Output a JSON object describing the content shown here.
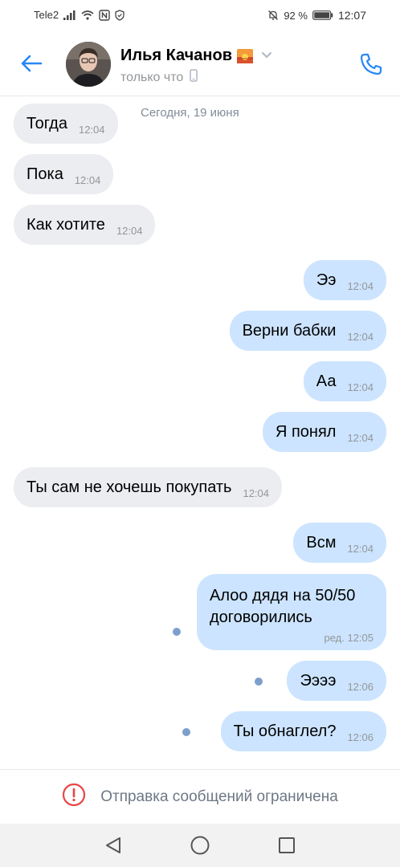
{
  "statusbar": {
    "carrier": "Tele2",
    "battery": "92 %",
    "time": "12:07"
  },
  "header": {
    "name": "Илья Качанов",
    "status": "только что"
  },
  "date_label": "Сегодня, 19 июня",
  "messages": [
    {
      "dir": "in",
      "text": "Тогда",
      "time": "12:04"
    },
    {
      "dir": "in",
      "text": "Пока",
      "time": "12:04"
    },
    {
      "dir": "in",
      "text": "Как хотите",
      "time": "12:04"
    },
    {
      "dir": "out",
      "text": "Ээ",
      "time": "12:04"
    },
    {
      "dir": "out",
      "text": "Верни бабки",
      "time": "12:04"
    },
    {
      "dir": "out",
      "text": "Аа",
      "time": "12:04"
    },
    {
      "dir": "out",
      "text": "Я понял",
      "time": "12:04"
    },
    {
      "dir": "in",
      "text": "Ты сам не хочешь покупать",
      "time": "12:04"
    },
    {
      "dir": "out",
      "text": "Всм",
      "time": "12:04"
    },
    {
      "dir": "out",
      "line1": "Алоо дядя на 50/50",
      "line2": "договорились",
      "time": "ред. 12:05",
      "unread": true
    },
    {
      "dir": "out",
      "text": "Ээээ",
      "time": "12:06",
      "unread": true
    },
    {
      "dir": "out",
      "text": "Ты обнаглел?",
      "time": "12:06",
      "unread": true
    }
  ],
  "footer": {
    "restriction_text": "Отправка сообщений ограничена"
  },
  "colors": {
    "accent": "#2787f5",
    "incoming_bubble": "#ebedf0",
    "outgoing_bubble": "#cce4ff",
    "error_red": "#e64646",
    "unread_dot": "#7d9fcc"
  }
}
